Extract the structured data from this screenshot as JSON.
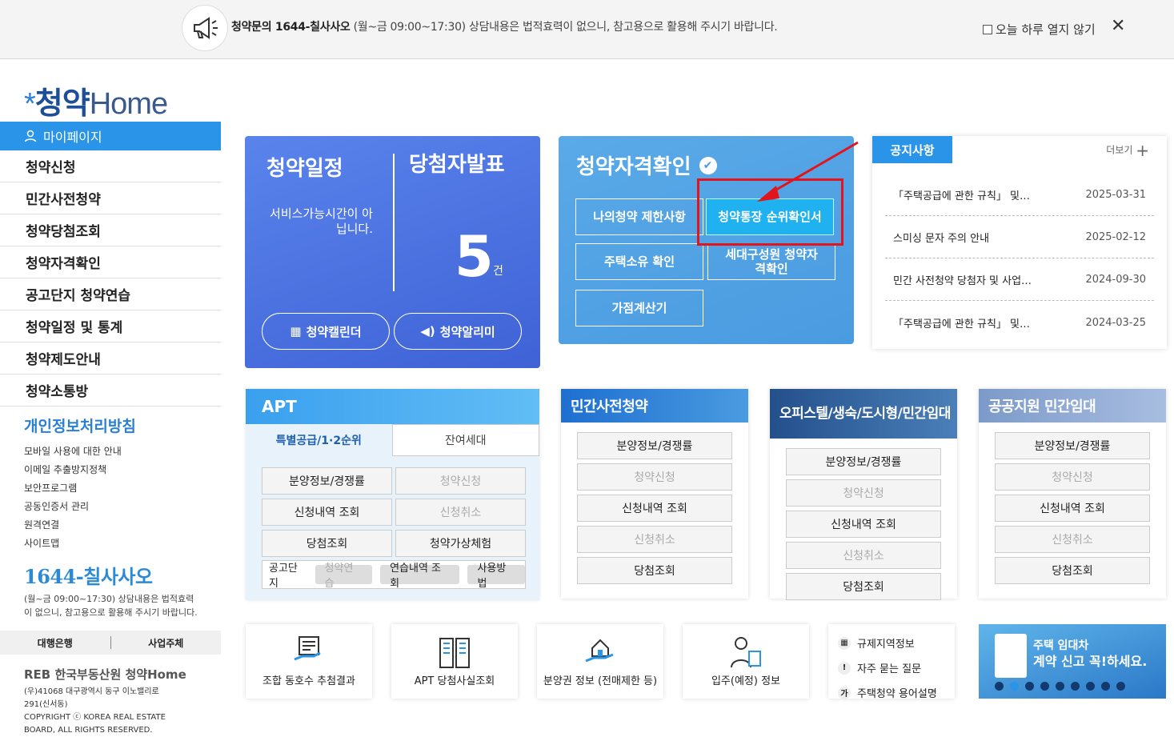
{
  "topbar": {
    "notice_bold": "청약문의 1644-칠사사오",
    "notice_rest": " (월~금 09:00~17:30) 상담내용은 법적효력이 없으니, 참고용으로 활용해 주시기 바랍니다.",
    "checkbox_label": "오늘 하루 열지 않기",
    "close": "✕"
  },
  "logo": {
    "star": "*",
    "text1": "청약",
    "text2": "Home"
  },
  "sidebar": {
    "mypage": "마이페이지",
    "items": [
      "청약신청",
      "민간사전청약",
      "청약당첨조회",
      "청약자격확인",
      "공고단지 청약연습",
      "청약일정 및 통계",
      "청약제도안내",
      "청약소통방"
    ],
    "policy_title": "개인정보처리방침",
    "policy_links": [
      "모바일 사용에 대한 안내",
      "이메일 추출방지정책",
      "보안프로그램",
      "공동인증서 관리",
      "원격연결",
      "사이트맵"
    ],
    "tel_prefix": "1644-",
    "tel_suffix": "칠사사오",
    "tel_desc": "(월~금 09:00~17:30) 상담내용은 법적효력이 없으니, 참고용으로 활용해 주시기 바랍니다.",
    "bank_a": "대행은행",
    "bank_b": "사업주체",
    "reb": "REB 한국부동산원 청약Home",
    "address": "(우)41068 대구광역시 동구 이노밸리로 291(신서동)",
    "copyright": "COPYRIGHT ⓒ KOREA REAL ESTATE BOARD, ALL RIGHTS RESERVED."
  },
  "schedule": {
    "title1": "청약일정",
    "title2": "당첨자발표",
    "message": "서비스가능시간이 아닙니다.",
    "count": "5",
    "unit": "건",
    "btn_calendar": "청약캘린더",
    "btn_alarm": "청약알리미"
  },
  "qualification": {
    "title": "청약자격확인",
    "btn_restriction": "나의청약 제한사항",
    "btn_certificate": "청약통장 순위확인서",
    "btn_housing": "주택소유 확인",
    "btn_household": "세대구성원 청약자격확인",
    "btn_points": "가점계산기"
  },
  "notices": {
    "tab": "공지사항",
    "more": "더보기",
    "items": [
      {
        "title": "「주택공급에 관한 규칙」 및…",
        "date": "2025-03-31"
      },
      {
        "title": "스미싱 문자 주의 안내",
        "date": "2025-02-12"
      },
      {
        "title": "민간 사전청약 당첨자 및 사업…",
        "date": "2024-09-30"
      },
      {
        "title": "「주택공급에 관한 규칙」 및…",
        "date": "2024-03-25"
      }
    ]
  },
  "apt": {
    "title": "APT",
    "tab_special": "특별공급/1·2순위",
    "tab_remaining": "잔여세대",
    "buttons": [
      "분양정보/경쟁률",
      "청약신청",
      "신청내역 조회",
      "신청취소",
      "당첨조회",
      "청약가상체험"
    ],
    "bottom_label": "공고단지",
    "bottom_btns": [
      "청약연습",
      "연습내역 조회",
      "사용방법"
    ]
  },
  "private_pre": {
    "title": "민간사전청약",
    "buttons": [
      "분양정보/경쟁률",
      "청약신청",
      "신청내역 조회",
      "신청취소",
      "당첨조회"
    ]
  },
  "officetel": {
    "title": "오피스텔/생숙/도시형/민간임대",
    "buttons": [
      "분양정보/경쟁률",
      "청약신청",
      "신청내역 조회",
      "신청취소",
      "당첨조회"
    ]
  },
  "public_rental": {
    "title": "공공지원 민간임대",
    "buttons": [
      "분양정보/경쟁률",
      "청약신청",
      "신청내역 조회",
      "신청취소",
      "당첨조회"
    ]
  },
  "tiles": [
    "조합 동호수 추첨결과",
    "APT 당첨사실조회",
    "분양권 정보 (전매제한 등)",
    "입주(예정) 정보"
  ],
  "links": [
    {
      "icon": "▦",
      "label": "규제지역정보"
    },
    {
      "icon": "!",
      "label": "자주 묻는 질문"
    },
    {
      "icon": "가",
      "label": "주택청약 용어설명"
    }
  ],
  "banner": {
    "line1": "주택 임대차",
    "line2": "계약 신고 꼭!하세요."
  }
}
